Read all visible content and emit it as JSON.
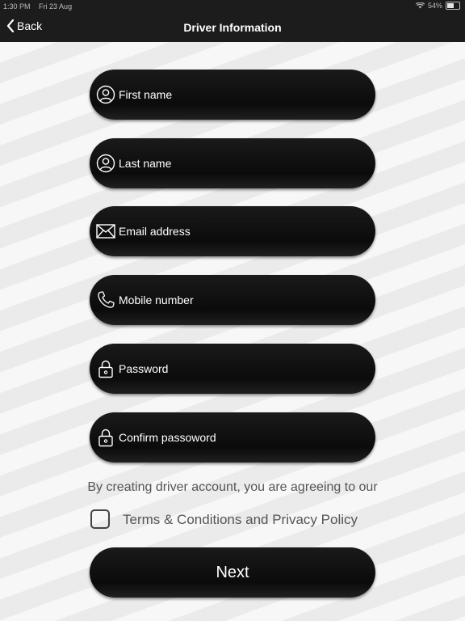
{
  "status_bar": {
    "time": "1:30 PM",
    "date": "Fri 23 Aug",
    "battery": "54%"
  },
  "nav": {
    "back_label": "Back",
    "title": "Driver Information"
  },
  "form": {
    "fields": [
      {
        "placeholder": "First name",
        "value": "",
        "icon": "person-icon"
      },
      {
        "placeholder": "Last name",
        "value": "",
        "icon": "person-icon"
      },
      {
        "placeholder": "Email address",
        "value": "",
        "icon": "envelope-icon"
      },
      {
        "placeholder": "Mobile number",
        "value": "",
        "icon": "phone-icon"
      },
      {
        "placeholder": "Password",
        "value": "",
        "icon": "lock-icon"
      },
      {
        "placeholder": "Confirm passoword",
        "value": "",
        "icon": "lock-icon"
      }
    ]
  },
  "agreement": {
    "text": "By creating driver account, you are agreeing to our",
    "terms_label": "Terms & Conditions and Privacy Policy",
    "checked": false
  },
  "next_label": "Next",
  "colors": {
    "bar": "#1c1c1c",
    "field": "#111111",
    "text_muted": "#555555"
  }
}
